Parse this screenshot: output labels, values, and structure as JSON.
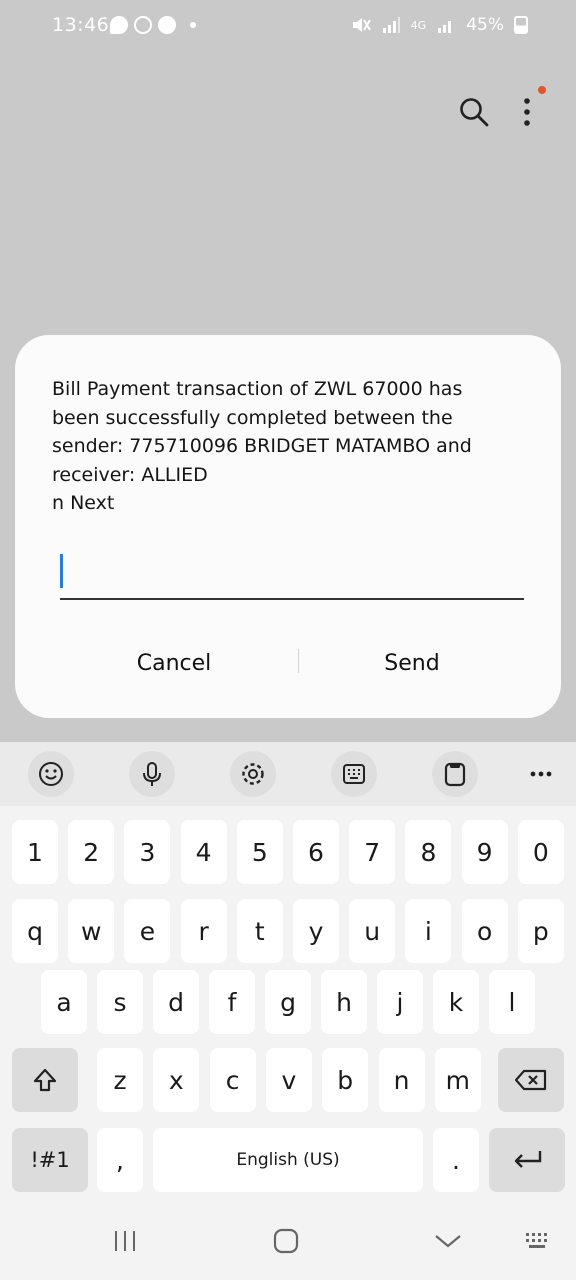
{
  "status_bar": {
    "time": "13:46",
    "battery": "45%",
    "network": "4G"
  },
  "top_bar": {
    "icons": [
      "search-icon",
      "more-vert-icon"
    ]
  },
  "dialog": {
    "message": "Bill Payment transaction of ZWL 67000 has\nbeen successfully completed between the\nsender: 775710096 BRIDGET MATAMBO and\nreceiver: ALLIED\nn Next",
    "input_value": "",
    "cancel_label": "Cancel",
    "send_label": "Send"
  },
  "keyboard": {
    "toolbar_icons": [
      "emoji-icon",
      "mic-icon",
      "settings-icon",
      "keypad-icon",
      "clipboard-icon",
      "more-horiz-icon"
    ],
    "numbers": [
      "1",
      "2",
      "3",
      "4",
      "5",
      "6",
      "7",
      "8",
      "9",
      "0"
    ],
    "row1": [
      "q",
      "w",
      "e",
      "r",
      "t",
      "y",
      "u",
      "i",
      "o",
      "p"
    ],
    "row2": [
      "a",
      "s",
      "d",
      "f",
      "g",
      "h",
      "j",
      "k",
      "l"
    ],
    "row3": [
      "z",
      "x",
      "c",
      "v",
      "b",
      "n",
      "m"
    ],
    "symbols_label": "!#1",
    "comma_label": ",",
    "space_label": "English (US)",
    "period_label": "."
  },
  "nav_bar": {
    "icons": [
      "recents-icon",
      "home-icon",
      "back-icon",
      "keyboard-hide-icon"
    ]
  }
}
